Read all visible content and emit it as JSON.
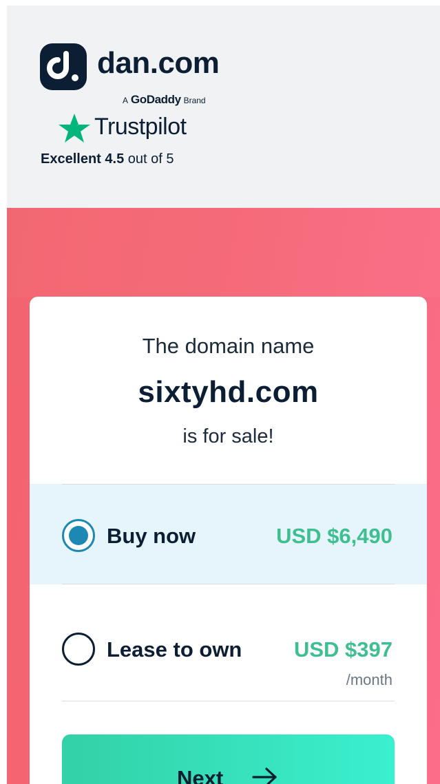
{
  "header": {
    "logo_text": "dan.com",
    "brand_prefix": "A",
    "brand_name": "GoDaddy",
    "brand_suffix": "Brand",
    "trustpilot_text": "Trustpilot",
    "rating_label": "Excellent",
    "rating_value": "4.5",
    "rating_suffix": "out of 5"
  },
  "card": {
    "intro_line": "The domain name",
    "domain": "sixtyhd.com",
    "sale_line": "is for sale!"
  },
  "options": [
    {
      "label": "Buy now",
      "price": "USD $6,490",
      "sub": "",
      "selected": true
    },
    {
      "label": "Lease to own",
      "price": "USD $397",
      "sub": "/month",
      "selected": false
    }
  ],
  "next_button": {
    "label": "Next",
    "icon": "arrow-right-icon"
  },
  "colors": {
    "navy": "#0b1e33",
    "price_green": "#3fbf8f",
    "selected_blue": "#1e88b5",
    "selected_bg": "#e6f4fb",
    "trustpilot_green": "#00b67a",
    "hero_coral": "#f56674"
  }
}
